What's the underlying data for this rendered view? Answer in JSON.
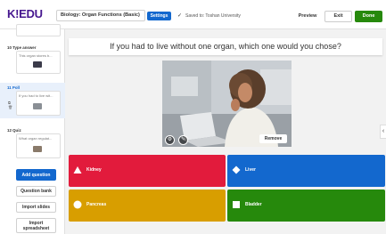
{
  "header": {
    "logo_text": "K!EDU",
    "title": "Biology: Organ Functions (Basic)",
    "settings_label": "Settings",
    "saved_text": "Saved to: Toshan University",
    "preview_label": "Preview",
    "exit_label": "Exit",
    "done_label": "Done"
  },
  "sidebar": {
    "slides": [
      {
        "num": "",
        "type": "",
        "question": ""
      },
      {
        "num": "10",
        "type": "Type answer",
        "question": "This organ stores b..."
      },
      {
        "num": "11",
        "type": "Poll",
        "question": "If you had to live wit..."
      },
      {
        "num": "12",
        "type": "Quiz",
        "question": "What organ regulat..."
      }
    ],
    "add_question_label": "Add question",
    "question_bank_label": "Question bank",
    "import_slides_label": "Import slides",
    "import_spreadsheet_label": "Import spreadsheet"
  },
  "main": {
    "question": "If you had to live without one organ, which one would you chose?",
    "remove_label": "Remove",
    "answers": [
      {
        "label": "Kidney",
        "color": "#e21b3c",
        "shape": "triangle"
      },
      {
        "label": "Liver",
        "color": "#1368ce",
        "shape": "diamond"
      },
      {
        "label": "Pancreas",
        "color": "#d89e00",
        "shape": "circle"
      },
      {
        "label": "Bladder",
        "color": "#26890c",
        "shape": "square"
      }
    ]
  },
  "colors": {
    "brand": "#46178f",
    "primary": "#1368ce",
    "done": "#26890c"
  }
}
